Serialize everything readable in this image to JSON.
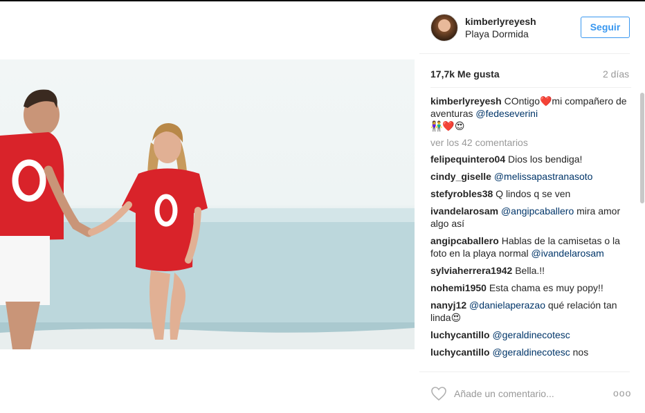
{
  "post": {
    "username": "kimberlyreyesh",
    "location": "Playa Dormida",
    "follow_label": "Seguir",
    "likes": "17,7k Me gusta",
    "time_ago": "2 días"
  },
  "caption": {
    "user": "kimberlyreyesh",
    "text_1": "COntigo",
    "heart": "❤️",
    "text_2": "mi compañero de aventuras",
    "mention": "@fedeseverini",
    "emojis": "👫❤️😍"
  },
  "view_all": "ver los 42 comentarios",
  "comments": [
    {
      "user": "felipequintero04",
      "mention": "",
      "text": "Dios los bendiga!"
    },
    {
      "user": "cindy_giselle",
      "mention": "@melissapastranasoto",
      "text": ""
    },
    {
      "user": "stefyrobles38",
      "mention": "",
      "text": "Q lindos q se ven"
    },
    {
      "user": "ivandelarosam",
      "mention": "@angipcaballero",
      "text": "mira amor algo así"
    },
    {
      "user": "angipcaballero",
      "mention": "",
      "text": "Hablas de la camisetas o la foto en la playa normal",
      "mention_after": "@ivandelarosam"
    },
    {
      "user": "sylviaherrera1942",
      "mention": "",
      "text": "Bella.!!"
    },
    {
      "user": "nohemi1950",
      "mention": "",
      "text": "Esta chama es muy popy!!"
    },
    {
      "user": "nanyj12",
      "mention": "@danielaperazao",
      "text": "qué relación tan linda😍"
    },
    {
      "user": "luchycantillo",
      "mention": "@geraldinecotesc",
      "text": ""
    },
    {
      "user": "luchycantillo",
      "mention": "@geraldinecotesc",
      "text": "nos"
    }
  ],
  "footer": {
    "placeholder": "Añade un comentario...",
    "more": "ooo"
  },
  "icons": {
    "like": "heart-outline-icon",
    "options": "more-options-icon"
  },
  "colors": {
    "accent": "#3897f0",
    "mention": "#003569",
    "shirt_red": "#d9232a"
  }
}
